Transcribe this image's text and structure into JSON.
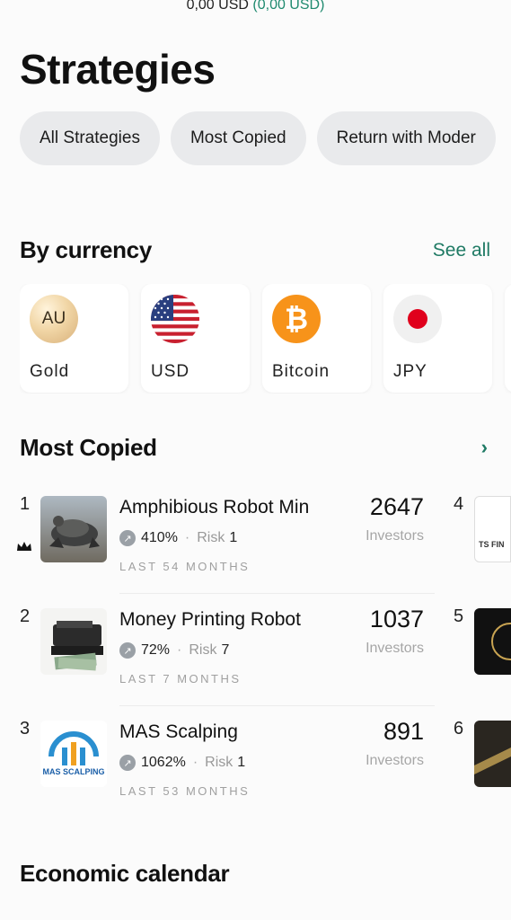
{
  "balance": {
    "main": "0,00 USD",
    "sub": "(0,00 USD)"
  },
  "page_title": "Strategies",
  "filters": [
    "All Strategies",
    "Most Copied",
    "Return with Moder"
  ],
  "by_currency": {
    "title": "By currency",
    "see_all": "See all",
    "items": [
      {
        "icon": "gold-coin-icon",
        "code": "AU",
        "label": "Gold"
      },
      {
        "icon": "us-flag-icon",
        "label": "USD"
      },
      {
        "icon": "bitcoin-icon",
        "code": "₿",
        "label": "Bitcoin"
      },
      {
        "icon": "japan-flag-icon",
        "label": "JPY"
      }
    ]
  },
  "most_copied": {
    "title": "Most Copied",
    "rows": [
      {
        "rank": "1",
        "name": "Amphibious Robot Min",
        "return": "410%",
        "risk_label": "Risk",
        "risk": "1",
        "period": "LAST 54 MONTHS",
        "investors": "2647",
        "investors_label": "Investors"
      },
      {
        "rank": "2",
        "name": "Money Printing Robot",
        "return": "72%",
        "risk_label": "Risk",
        "risk": "7",
        "period": "LAST 7 MONTHS",
        "investors": "1037",
        "investors_label": "Investors"
      },
      {
        "rank": "3",
        "name": "MAS Scalping",
        "return": "1062%",
        "risk_label": "Risk",
        "risk": "1",
        "period": "LAST 53 MONTHS",
        "investors": "891",
        "investors_label": "Investors"
      }
    ],
    "next_column_ranks": [
      "4",
      "5",
      "6"
    ],
    "thumb_texts": {
      "rank4": "TS FIN",
      "rank3": "MAS SCALPING"
    }
  },
  "economic_calendar": {
    "title": "Economic calendar"
  }
}
